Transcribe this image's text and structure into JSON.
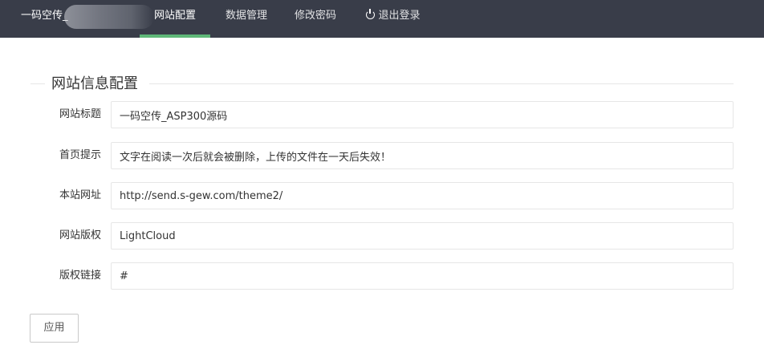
{
  "header": {
    "brand": "一码空传_",
    "nav": [
      {
        "label": "网站配置",
        "active": true
      },
      {
        "label": "数据管理",
        "active": false
      },
      {
        "label": "修改密码",
        "active": false
      },
      {
        "label": "退出登录",
        "active": false,
        "icon": "power-icon"
      }
    ]
  },
  "section": {
    "title": "网站信息配置"
  },
  "form": {
    "fields": [
      {
        "label": "网站标题",
        "value": "一码空传_ASP300源码"
      },
      {
        "label": "首页提示",
        "value": "文字在阅读一次后就会被删除，上传的文件在一天后失效！"
      },
      {
        "label": "本站网址",
        "value": "http://send.s-gew.com/theme2/"
      },
      {
        "label": "网站版权",
        "value": "LightCloud"
      },
      {
        "label": "版权链接",
        "value": "#"
      }
    ],
    "submit_label": "应用"
  },
  "colors": {
    "topbar": "#393d49",
    "accent": "#5fb878"
  }
}
